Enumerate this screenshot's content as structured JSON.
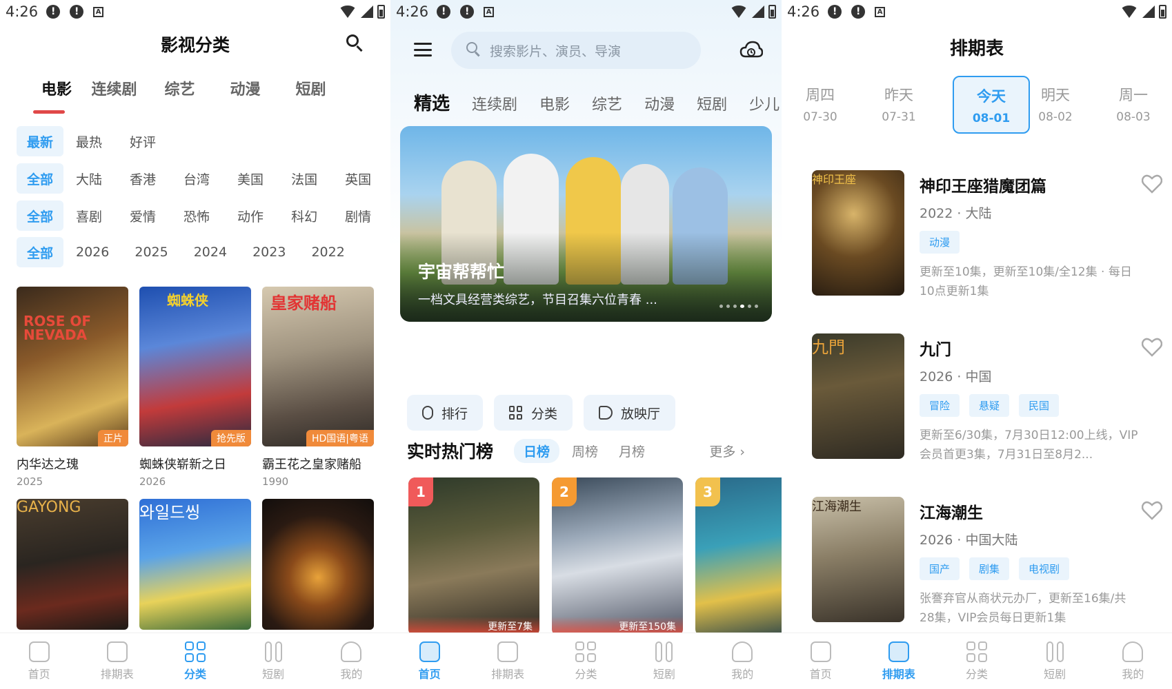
{
  "status_bar": {
    "time": "4:26",
    "icon_a": "A",
    "icon_b": "!",
    "icons": [
      "alert-circle-icon",
      "alert-circle-icon",
      "a-box-icon",
      "wifi-icon",
      "cell-signal-icon",
      "battery-icon"
    ]
  },
  "colors": {
    "accent": "#2f9cf0",
    "underline": "#e04848",
    "badge": "#f08a3a",
    "rank1": "#f05a5a",
    "rank2": "#f59a32",
    "rank3": "#f2c14e"
  },
  "panel1": {
    "title": "影视分类",
    "tabs": [
      "电影",
      "连续剧",
      "综艺",
      "动漫",
      "短剧"
    ],
    "sort_row": {
      "active": "最新",
      "options": [
        "最热",
        "好评"
      ]
    },
    "region_row": {
      "active": "全部",
      "options": [
        "大陆",
        "香港",
        "台湾",
        "美国",
        "法国",
        "英国"
      ]
    },
    "genre_row": {
      "active": "全部",
      "options": [
        "喜剧",
        "爱情",
        "恐怖",
        "动作",
        "科幻",
        "剧情"
      ]
    },
    "year_row": {
      "active": "全部",
      "options": [
        "2026",
        "2025",
        "2024",
        "2023",
        "2022"
      ]
    },
    "movies": [
      {
        "title": "内华达之瑰",
        "year": "2025",
        "badge": "正片",
        "poster_text": "ROSE OF NEVADA"
      },
      {
        "title": "蜘蛛侠崭新之日",
        "year": "2026",
        "badge": "抢先版",
        "poster_text": "蜘蛛侠"
      },
      {
        "title": "霸王花之皇家赌船",
        "year": "1990",
        "badge": "HD国语|粤语",
        "poster_text": "皇家赌船"
      }
    ],
    "movies_row2": [
      {
        "poster_text": "GAYONG"
      },
      {
        "poster_text": "와일드씽"
      },
      {
        "poster_text": ""
      }
    ]
  },
  "panel2": {
    "search_placeholder": "搜索影片、演员、导演",
    "tabs": [
      "精选",
      "连续剧",
      "电影",
      "综艺",
      "动漫",
      "短剧",
      "少儿"
    ],
    "banner": {
      "title": "宇宙帮帮忙",
      "subtitle": "一档文具经营类综艺，节目召集六位青春 ..."
    },
    "quick_buttons": [
      "排行",
      "分类",
      "放映厅"
    ],
    "hot": {
      "title": "实时热门榜",
      "tabs": [
        "日榜",
        "周榜",
        "月榜"
      ],
      "more": "更多 ›"
    },
    "hot_cards": [
      {
        "rank": "1",
        "update": "更新至7集"
      },
      {
        "rank": "2",
        "update": "更新至150集"
      },
      {
        "rank": "3",
        "update": ""
      }
    ]
  },
  "panel3": {
    "title": "排期表",
    "days": [
      {
        "weekday": "周四",
        "date": "07-30"
      },
      {
        "weekday": "昨天",
        "date": "07-31"
      },
      {
        "weekday": "今天",
        "date": "08-01"
      },
      {
        "weekday": "明天",
        "date": "08-02"
      },
      {
        "weekday": "周一",
        "date": "08-03"
      }
    ],
    "schedule": [
      {
        "title": "神印王座猎魔团篇",
        "meta": "2022 · 大陆",
        "tags": [
          "动漫"
        ],
        "desc": "更新至10集，更新至10集/全12集 · 每日10点更新1集",
        "poster_text": "神印王座"
      },
      {
        "title": "九门",
        "meta": "2026 · 中国",
        "tags": [
          "冒险",
          "悬疑",
          "民国"
        ],
        "desc": "更新至6/30集，7月30日12:00上线，VIP会员首更3集，7月31日至8月2...",
        "poster_text": "九門"
      },
      {
        "title": "江海潮生",
        "meta": "2026 · 中国大陆",
        "tags": [
          "国产",
          "剧集",
          "电视剧"
        ],
        "desc": "张謇弃官从商状元办厂，更新至16集/共28集，VIP会员每日更新1集",
        "poster_text": "江海潮生"
      }
    ]
  },
  "nav": {
    "labels": [
      "首页",
      "排期表",
      "分类",
      "短剧",
      "我的"
    ]
  }
}
